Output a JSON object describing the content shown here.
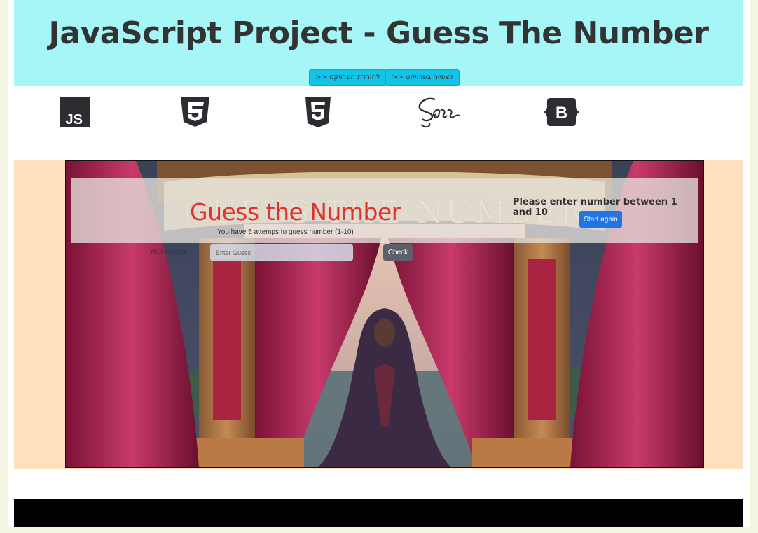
{
  "header": {
    "title": "JavaScript Project - Guess The Number",
    "download_button": "להורדת הפרויקט <<",
    "view_button": "לצפייה בפרויקט <<",
    "bg_color": "#a6f6f8",
    "button_color": "#14c4e8"
  },
  "tech_logos": [
    {
      "name": "js-logo-icon",
      "label": "JS"
    },
    {
      "name": "css3-logo-icon",
      "label": "3"
    },
    {
      "name": "html5-logo-icon",
      "label": "5"
    },
    {
      "name": "sass-logo-icon",
      "label": "Sass"
    },
    {
      "name": "bootstrap-logo-icon",
      "label": "B"
    }
  ],
  "game": {
    "title": "Guess the Number",
    "subtitle": "You have 5 attemps to guess number (1-10)",
    "guess_label": "Your Guess:",
    "input_placeholder": "Enter Guess",
    "input_value": "",
    "check_button": "Check",
    "message": "Please enter number between 1 and 10",
    "start_again_button": "Start again",
    "banner_text": "GUESS THE NUMBER",
    "title_color": "#e0312c",
    "section_bg": "#fde0bd"
  },
  "footer": {
    "bg_color": "#000000"
  }
}
